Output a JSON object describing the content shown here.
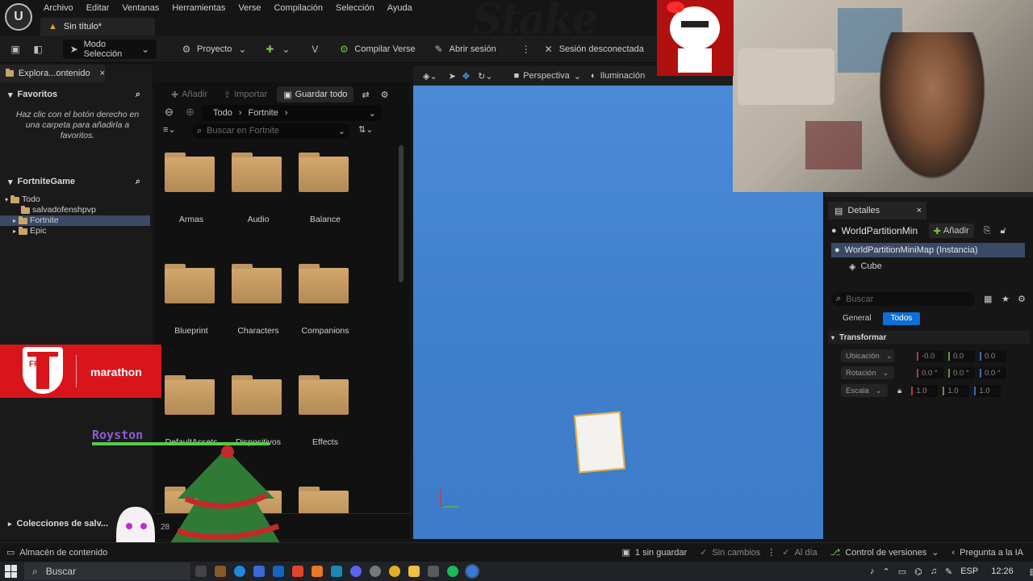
{
  "menubar": {
    "items": [
      "Archivo",
      "Editar",
      "Ventanas",
      "Herramientas",
      "Verse",
      "Compilación",
      "Selección",
      "Ayuda"
    ],
    "document_tab": "Sin título*"
  },
  "toolbar": {
    "mode": "Modo Selección",
    "project": "Proyecto",
    "compile_verse": "Compilar Verse",
    "open_session": "Abrir sesión",
    "session_status": "Sesión desconectada"
  },
  "watermark": "Stake",
  "left_panel": {
    "tab_label": "Explora...ontenido",
    "favorites_title": "Favoritos",
    "favorites_hint": "Haz clic con el botón derecho en una carpeta para añadirla a favoritos.",
    "game_title": "FortniteGame",
    "tree": [
      "Todo",
      "salvadofenshpvp",
      "Fortnite",
      "Epic"
    ],
    "selected": "Fortnite",
    "collections": "Colecciones de salv..."
  },
  "content_browser": {
    "add": "Añadir",
    "import": "Importar",
    "save_all": "Guardar todo",
    "path": [
      "Todo",
      "Fortnite"
    ],
    "search_placeholder": "Buscar en Fortnite",
    "folders": [
      "Armas",
      "Audio",
      "Balance",
      "Blueprint",
      "Characters",
      "Companions",
      "DefaultAssets",
      "Dispositivos",
      "Effects"
    ],
    "item_count_fragment": "28"
  },
  "viewport": {
    "perspective": "Perspectiva",
    "lighting": "Iluminación"
  },
  "details": {
    "tab": "Detalles",
    "actor_name": "WorldPartitionMin",
    "add": "Añadir",
    "selected_item": "WorldPartitionMiniMap (Instancia)",
    "child_item": "Cube",
    "search_placeholder": "Buscar",
    "tabs": [
      "General",
      "Todos"
    ],
    "active_tab": "Todos",
    "section": "Transformar",
    "location_label": "Ubicación",
    "rotation_label": "Rotación",
    "scale_label": "Escala",
    "location": [
      "-0.0",
      "0.0",
      "0.0"
    ],
    "rotation": [
      "0.0 °",
      "0.0 °",
      "0.0 °"
    ],
    "scale": [
      "1.0",
      "1.0",
      "1.0"
    ]
  },
  "statusbar": {
    "content_drawer": "Almacén de contenido",
    "unsaved": "1 sin guardar",
    "no_changes": "Sin cambios",
    "up_to_date": "Al día",
    "version_control": "Control de versiones",
    "ask_ai": "Pregunta a la IA"
  },
  "taskbar": {
    "search": "Buscar",
    "language": "ESP",
    "time": "12:26"
  },
  "overlays": {
    "sponsor": "marathon",
    "sponsor_logo": "FPF",
    "username": "Royston"
  },
  "colors": {
    "accent_blue": "#0e6fd6",
    "folder": "#c9a56a",
    "viewport_sky": "#3e7fcb"
  }
}
